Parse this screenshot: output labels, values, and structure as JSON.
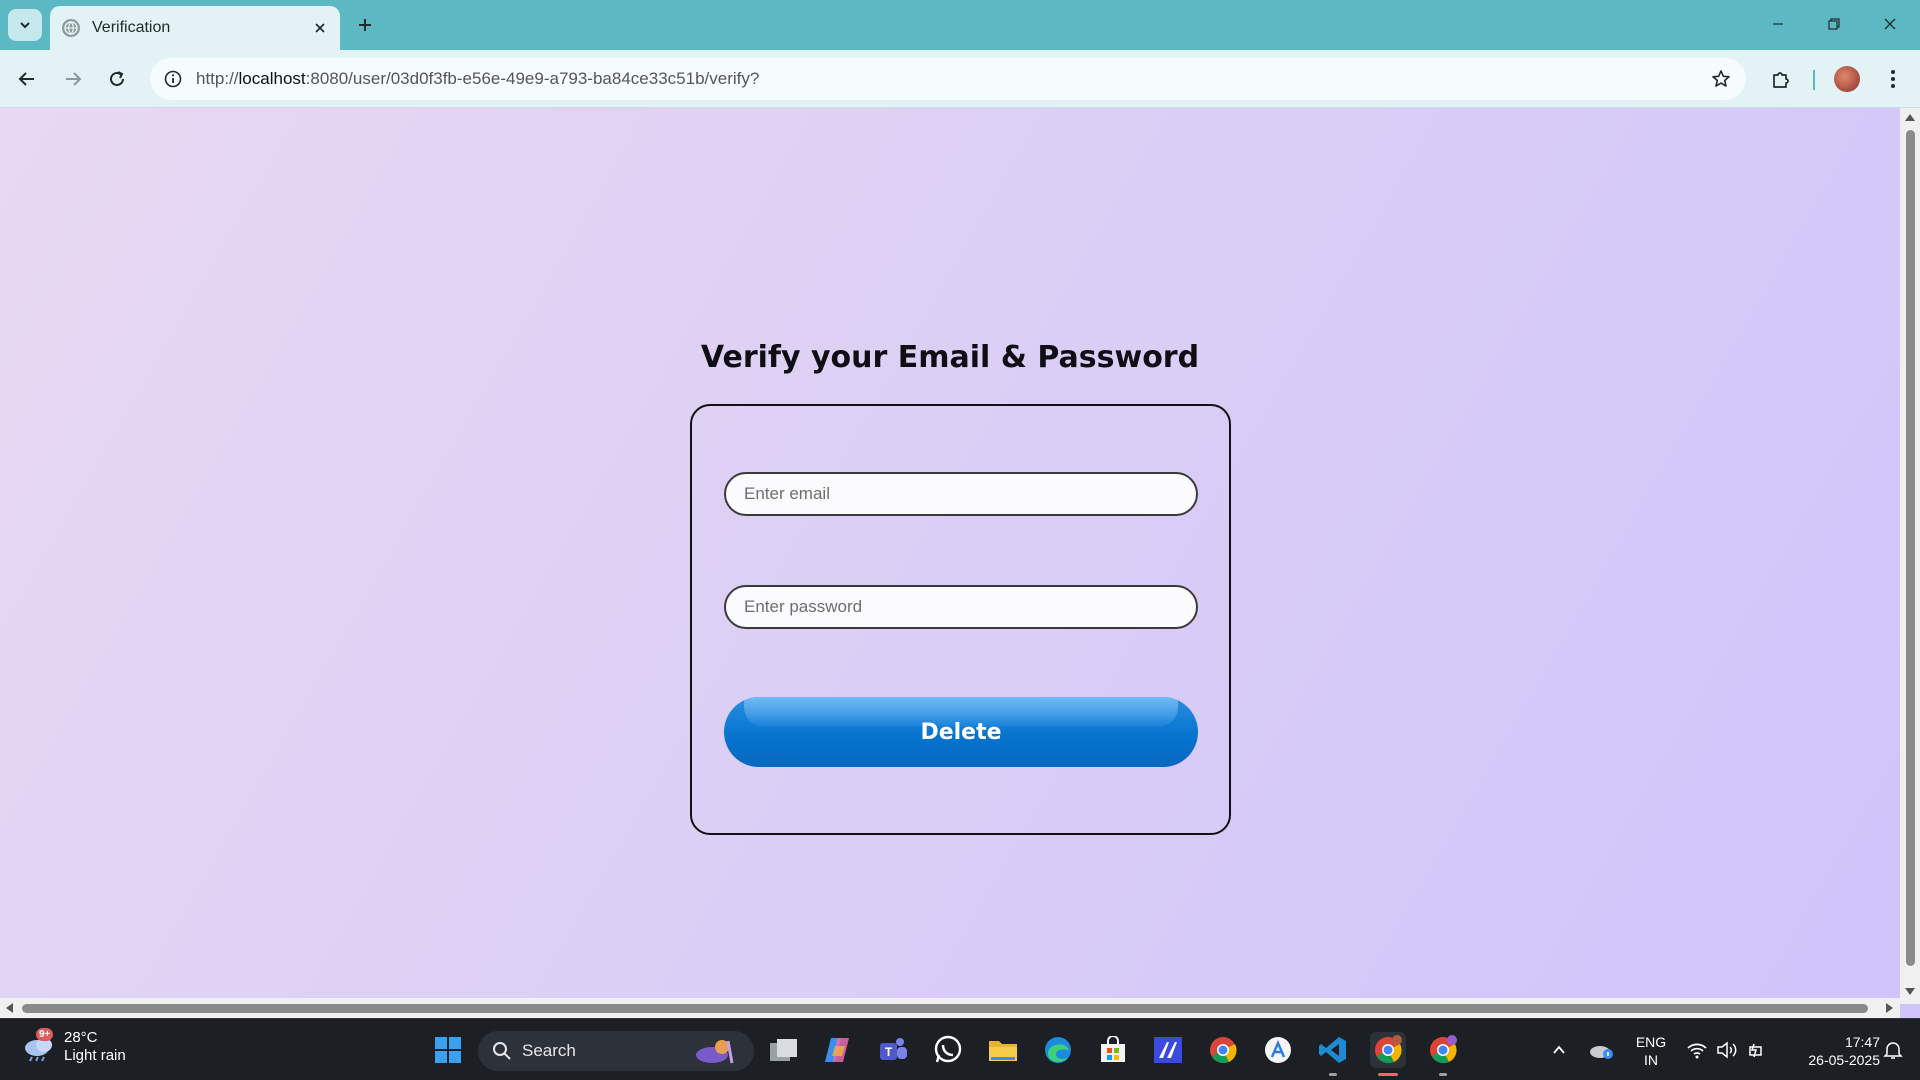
{
  "browser": {
    "tab_title": "Verification",
    "url_prefix": "http://",
    "url_host": "localhost",
    "url_path": ":8080/user/03d0f3fb-e56e-49e9-a793-ba84ce33c51b/verify?"
  },
  "page": {
    "heading": "Verify your Email & Password",
    "email_placeholder": "Enter email",
    "password_placeholder": "Enter password",
    "delete_label": "Delete"
  },
  "taskbar": {
    "weather_badge": "9+",
    "temperature": "28°C",
    "condition": "Light rain",
    "search_label": "Search",
    "lang_line1": "ENG",
    "lang_line2": "IN",
    "time": "17:47",
    "date": "26-05-2025",
    "icons": [
      "windows-start-icon",
      "task-view-icon",
      "copilot-icon",
      "teams-icon",
      "whatsapp-icon",
      "file-explorer-icon",
      "edge-icon",
      "microsoft-store-icon",
      "app-icon",
      "chrome-icon",
      "app-store-icon",
      "vscode-icon",
      "chrome-profile-icon",
      "chrome-profile-2-icon"
    ]
  },
  "colors": {
    "tab_strip": "#5cb8c3",
    "toolbar": "#e3f3f5",
    "button_blue": "#0674cf",
    "taskbar": "#1c1f24"
  }
}
